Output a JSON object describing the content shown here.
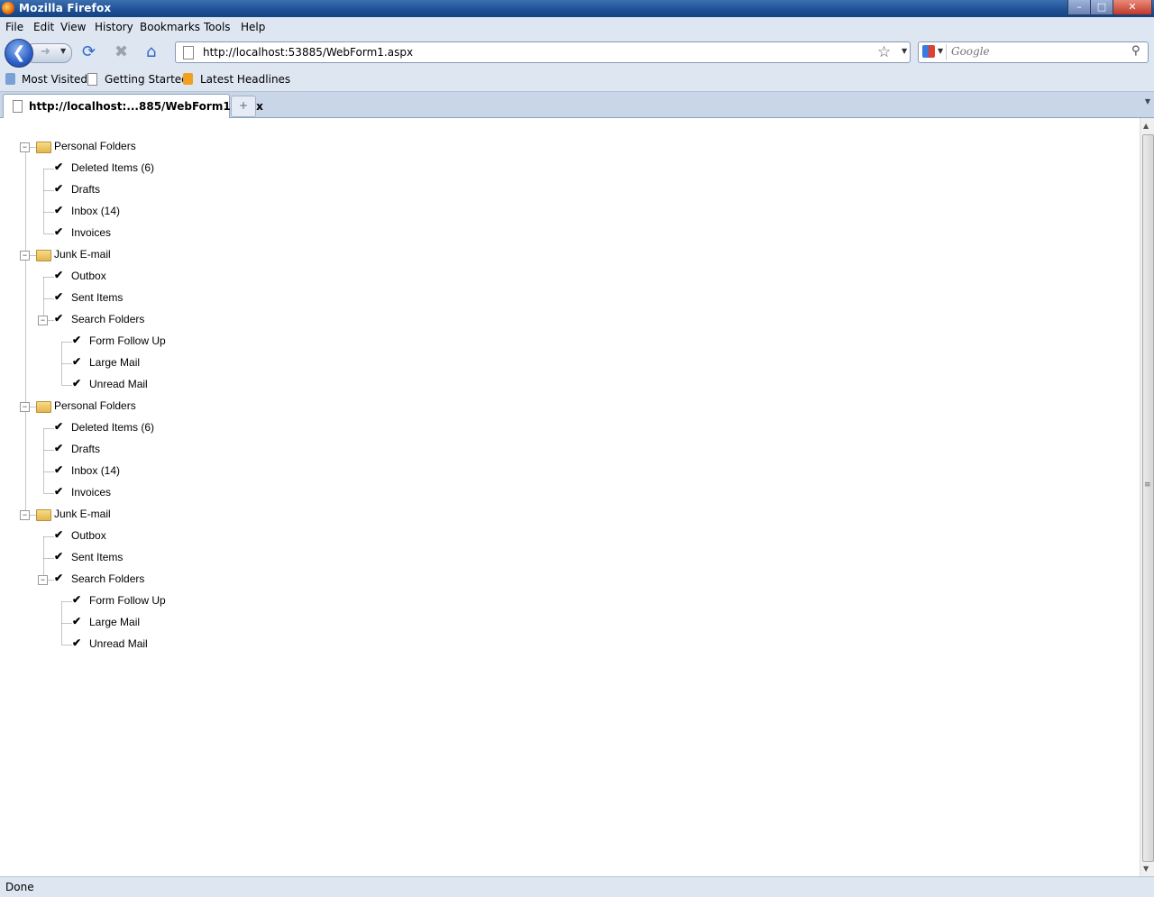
{
  "window": {
    "title": "Mozilla Firefox"
  },
  "menu": [
    "File",
    "Edit",
    "View",
    "History",
    "Bookmarks",
    "Tools",
    "Help"
  ],
  "navigation": {
    "url": "http://localhost:53885/WebForm1.aspx",
    "search_placeholder": "Google"
  },
  "bookmarks": [
    "Most Visited",
    "Getting Started",
    "Latest Headlines"
  ],
  "tab": {
    "title": "http://localhost:...885/WebForm1.aspx",
    "new_tab": "+"
  },
  "status": "Done",
  "tree": [
    {
      "label": "Personal Folders",
      "level": 0,
      "type": "folder",
      "expander": "collapse"
    },
    {
      "label": "Deleted Items (6)",
      "level": 1,
      "type": "check"
    },
    {
      "label": "Drafts",
      "level": 1,
      "type": "check"
    },
    {
      "label": "Inbox (14)",
      "level": 1,
      "type": "check"
    },
    {
      "label": "Invoices",
      "level": 1,
      "type": "check"
    },
    {
      "label": "Junk E-mail",
      "level": 0,
      "type": "folder",
      "expander": "collapse"
    },
    {
      "label": "Outbox",
      "level": 1,
      "type": "check"
    },
    {
      "label": "Sent Items",
      "level": 1,
      "type": "check"
    },
    {
      "label": "Search Folders",
      "level": 1,
      "type": "check",
      "expander": "collapse"
    },
    {
      "label": "Form Follow Up",
      "level": 2,
      "type": "check"
    },
    {
      "label": "Large Mail",
      "level": 2,
      "type": "check"
    },
    {
      "label": "Unread Mail",
      "level": 2,
      "type": "check"
    },
    {
      "label": "Personal Folders",
      "level": 0,
      "type": "folder",
      "expander": "collapse"
    },
    {
      "label": "Deleted Items (6)",
      "level": 1,
      "type": "check"
    },
    {
      "label": "Drafts",
      "level": 1,
      "type": "check"
    },
    {
      "label": "Inbox (14)",
      "level": 1,
      "type": "check"
    },
    {
      "label": "Invoices",
      "level": 1,
      "type": "check"
    },
    {
      "label": "Junk E-mail",
      "level": 0,
      "type": "folder",
      "expander": "collapse"
    },
    {
      "label": "Outbox",
      "level": 1,
      "type": "check"
    },
    {
      "label": "Sent Items",
      "level": 1,
      "type": "check"
    },
    {
      "label": "Search Folders",
      "level": 1,
      "type": "check",
      "expander": "collapse"
    },
    {
      "label": "Form Follow Up",
      "level": 2,
      "type": "check"
    },
    {
      "label": "Large Mail",
      "level": 2,
      "type": "check"
    },
    {
      "label": "Unread Mail",
      "level": 2,
      "type": "check"
    }
  ]
}
